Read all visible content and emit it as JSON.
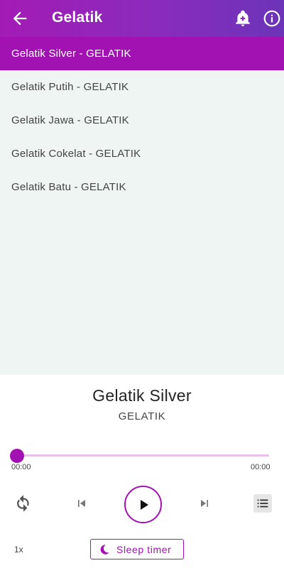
{
  "appbar": {
    "title": "Gelatik"
  },
  "playlist": [
    {
      "label": "Gelatik Silver - GELATIK",
      "active": true
    },
    {
      "label": "Gelatik Putih - GELATIK",
      "active": false
    },
    {
      "label": "Gelatik Jawa - GELATIK",
      "active": false
    },
    {
      "label": "Gelatik Cokelat - GELATIK",
      "active": false
    },
    {
      "label": "Gelatik Batu - GELATIK",
      "active": false
    }
  ],
  "player": {
    "title": "Gelatik Silver",
    "artist": "GELATIK",
    "time_current": "00:00",
    "time_total": "00:00",
    "progress": 0,
    "speed": "1x",
    "sleep_timer_label": "Sleep timer"
  },
  "colors": {
    "accent": "#a212b3",
    "appbar_start": "#a31bb5",
    "appbar_end": "#6b34b8",
    "list_bg": "#eef5f3"
  },
  "icons": {
    "back": "arrow-left-icon",
    "bell": "bell-icon",
    "info": "info-icon",
    "repeat": "repeat-icon",
    "previous": "skip-previous-icon",
    "play": "play-icon",
    "next": "skip-next-icon",
    "queue": "queue-list-icon",
    "moon": "moon-icon"
  }
}
